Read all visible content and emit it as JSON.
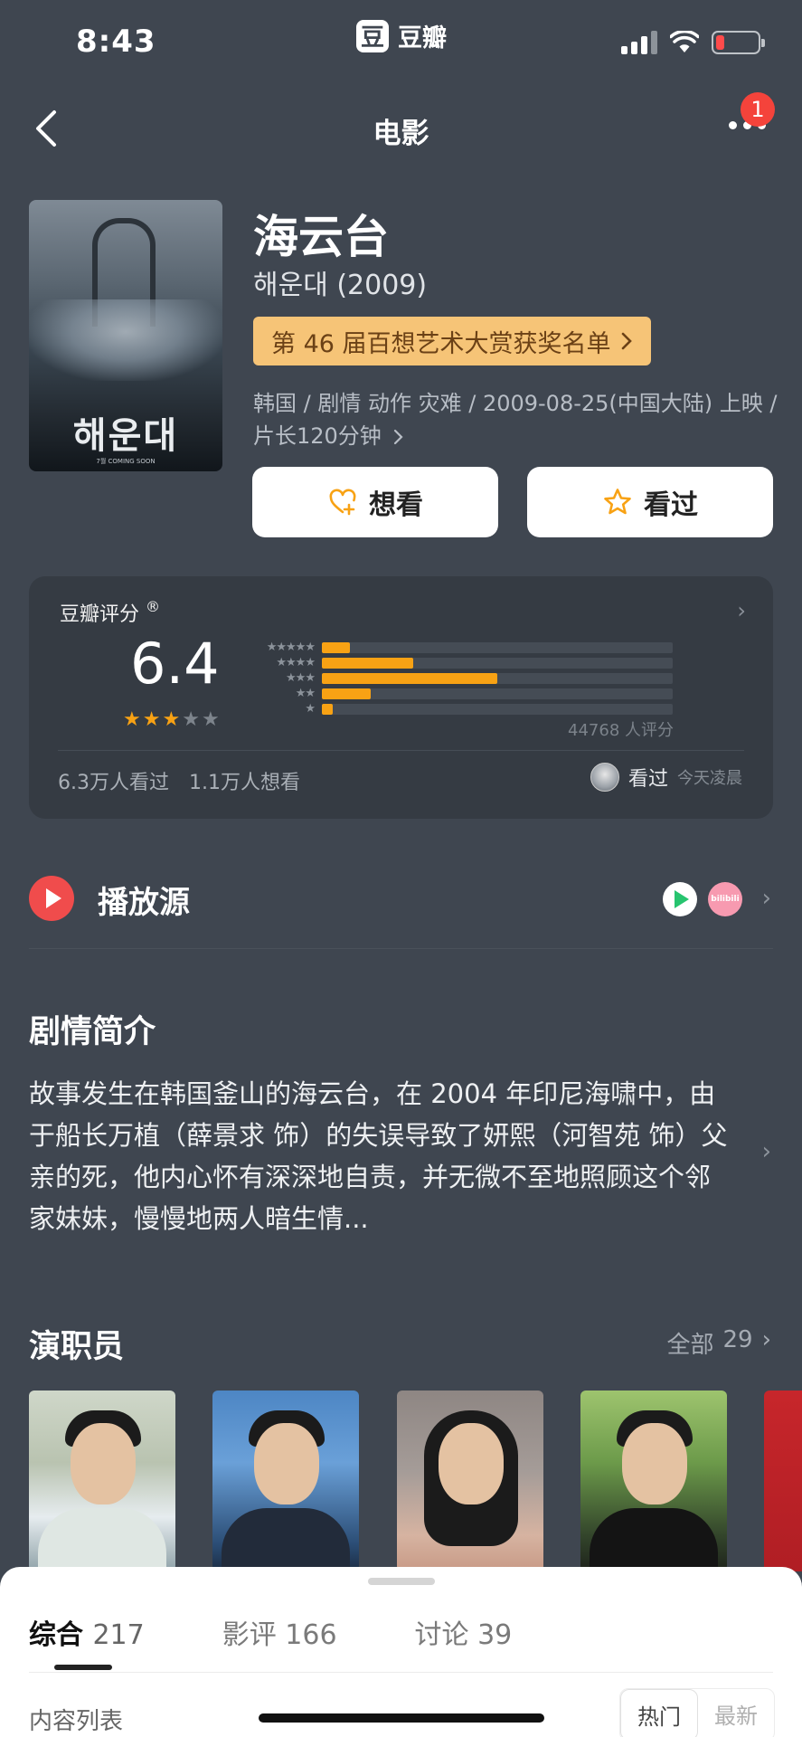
{
  "status": {
    "time": "8:43",
    "app_logo": "豆",
    "app_name": "豆瓣"
  },
  "nav": {
    "title": "电影",
    "badge": "1"
  },
  "poster": {
    "title": "해운대",
    "tagline": "7월 COMING SOON"
  },
  "movie": {
    "title": "海云台",
    "original_title": "해운대 (2009)",
    "award": "第 46 届百想艺术大赏获奖名单",
    "meta_line1": "韩国 / 剧情 动作 灾难 / 2009-08-25(中国大陆) 上映 /",
    "meta_line2": "片长120分钟"
  },
  "actions": {
    "want": "想看",
    "seen": "看过"
  },
  "rating": {
    "label": "豆瓣评分",
    "registered": "®",
    "score": "6.4",
    "stars_filled": 3,
    "stars_total": 5,
    "distribution": [
      {
        "stars": "★★★★★",
        "percent": 8
      },
      {
        "stars": "★★★★",
        "percent": 26
      },
      {
        "stars": "★★★",
        "percent": 50
      },
      {
        "stars": "★★",
        "percent": 14
      },
      {
        "stars": "★",
        "percent": 3
      }
    ],
    "count": "44768 人评分",
    "watched": "6.3万人看过",
    "wishlist": "1.1万人想看",
    "my_status": "看过",
    "my_time": "今天凌晨"
  },
  "play": {
    "label": "播放源",
    "platform2": "bilibili"
  },
  "synopsis": {
    "title": "剧情简介",
    "text": "故事发生在韩国釜山的海云台，在 2004 年印尼海啸中，由于船长万植（薛景求 饰）的失误导致了妍熙（河智苑 饰）父亲的死，他内心怀有深深地自责，并无微不至地照顾这个邻家妹妹，慢慢地两人暗生情..."
  },
  "cast": {
    "title": "演职员",
    "all_label": "全部",
    "all_count": "29"
  },
  "sheet": {
    "tabs": [
      {
        "label": "综合",
        "count": "217"
      },
      {
        "label": "影评",
        "count": "166"
      },
      {
        "label": "讨论",
        "count": "39"
      }
    ],
    "list_label": "内容列表",
    "sort_hot": "热门",
    "sort_new": "最新"
  },
  "colors": {
    "background": "#3f4650",
    "accent_orange": "#f8a214",
    "award_bg": "#f6c477",
    "play_red": "#f04c4c"
  }
}
